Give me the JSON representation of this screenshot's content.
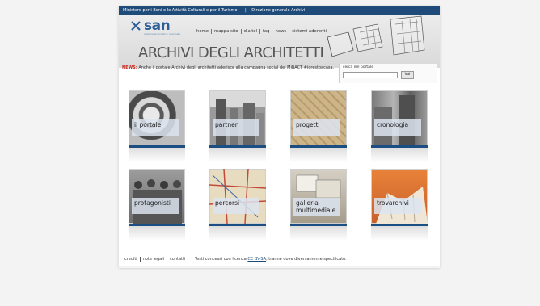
{
  "topbar": {
    "left": "Ministero per i Beni e le Attività Culturali e per il Turismo",
    "right": "Direzione generale Archivi"
  },
  "brand": {
    "logo": "san",
    "logo_sub": "sistema archivistico nazionale",
    "title": "ARCHIVI DEGLI ARCHITETTI"
  },
  "nav": [
    "home",
    "mappa sito",
    "dialtel",
    "faq",
    "news",
    "sistemi aderenti"
  ],
  "notice": {
    "lead": "NEWS:",
    "text": "Anche il portale Archivi degli architetti aderisce alla campagna social del MiBACT #iorestoacasa."
  },
  "search": {
    "label": "cerca nel portale",
    "placeholder": "",
    "button": "Vai"
  },
  "tiles": [
    {
      "label": "il portale"
    },
    {
      "label": "partner"
    },
    {
      "label": "progetti"
    },
    {
      "label": "cronologia"
    },
    {
      "label": "protagonisti"
    },
    {
      "label": "percorsi"
    },
    {
      "label": "galleria multimediale"
    },
    {
      "label": "trovarchivi"
    }
  ],
  "footer": {
    "links": [
      "crediti",
      "note legali",
      "contatti"
    ],
    "license_prefix": "Testi concessi con licenza",
    "license_link": "CC BY-SA",
    "license_suffix": ", tranne dove diversamente specificato."
  },
  "colors": {
    "brand_blue": "#1f4b7a",
    "accent_red": "#c8281e"
  }
}
